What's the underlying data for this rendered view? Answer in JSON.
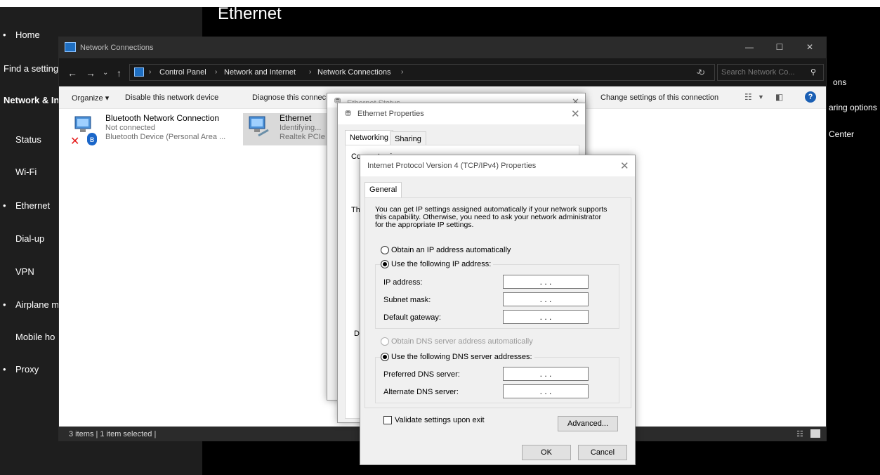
{
  "settings": {
    "nav_items": [
      {
        "label": "Home",
        "bullet": true
      },
      {
        "label": "Find a setting",
        "cut": true
      },
      {
        "label": "Network & Inte",
        "cut": true,
        "bold": true
      },
      {
        "label": "Status"
      },
      {
        "label": "Wi-Fi"
      },
      {
        "label": "Ethernet",
        "bullet": true
      },
      {
        "label": "Dial-up"
      },
      {
        "label": "VPN"
      },
      {
        "label": "Airplane m",
        "bullet": true
      },
      {
        "label": "Mobile ho"
      },
      {
        "label": "Proxy",
        "bullet": true
      }
    ],
    "heading": "Ethernet",
    "right_links": [
      "ons",
      "aring options",
      "Center"
    ]
  },
  "explorer": {
    "title": "Network Connections",
    "window_controls": {
      "minimize": "—",
      "maximize": "☐",
      "close": "✕"
    },
    "breadcrumbs": [
      "Control Panel",
      "Network and Internet",
      "Network Connections"
    ],
    "search_placeholder": "Search Network Co...",
    "toolbar": {
      "organize": "Organize ▾",
      "disable": "Disable this network device",
      "diagnose": "Diagnose this connec",
      "rename_fragment": "n",
      "change_settings": "Change settings of this connection"
    },
    "connections": [
      {
        "name": "Bluetooth Network Connection",
        "status": "Not connected",
        "device": "Bluetooth Device (Personal Area ..."
      },
      {
        "name": "Ethernet",
        "status": "Identifying...",
        "device": "Realtek PCIe"
      }
    ],
    "status_bar": "3 items  |  1 item selected  |"
  },
  "ethernet_status_dialog": {
    "title": "Ethernet Status"
  },
  "ethernet_properties_dialog": {
    "title": "Ethernet Properties",
    "tabs": [
      "Networking",
      "Sharing"
    ],
    "connect_label": "Connect using:",
    "this_fragment": "Th",
    "d_fragment": "D"
  },
  "ipv4_dialog": {
    "title": "Internet Protocol Version 4 (TCP/IPv4) Properties",
    "tab": "General",
    "intro_lines": [
      "You can get IP settings assigned automatically if your network supports",
      "this capability. Otherwise, you need to ask your network administrator",
      "for the appropriate IP settings."
    ],
    "obtain_ip_auto": "Obtain an IP address automatically",
    "use_following_ip": "Use the following IP address:",
    "ip_address_label": "IP address:",
    "subnet_mask_label": "Subnet mask:",
    "default_gateway_label": "Default gateway:",
    "obtain_dns_auto": "Obtain DNS server address automatically",
    "use_following_dns": "Use the following DNS server addresses:",
    "preferred_dns_label": "Preferred DNS server:",
    "alternate_dns_label": "Alternate DNS server:",
    "validate_label": "Validate settings upon exit",
    "advanced_button": "Advanced...",
    "ok_button": "OK",
    "cancel_button": "Cancel",
    "ip_dots": ".     .     ."
  }
}
